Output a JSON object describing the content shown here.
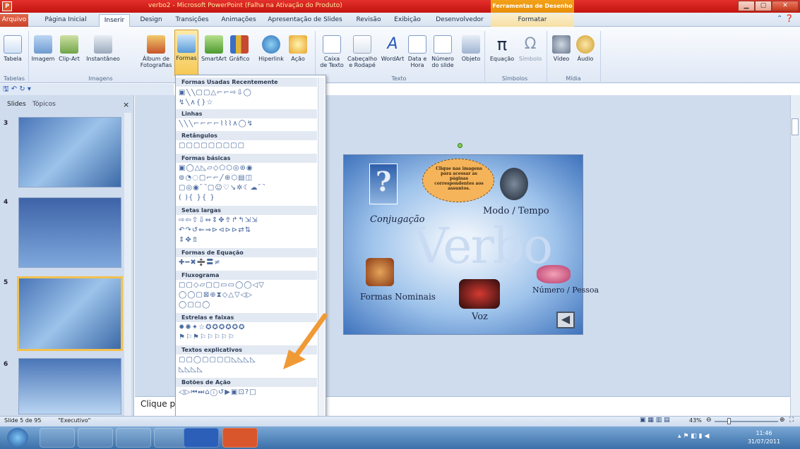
{
  "titlebar": {
    "title": "verbo2 - Microsoft PowerPoint (Falha na Ativação do Produto)",
    "context_tab": "Ferramentas de Desenho",
    "app_icon": "P"
  },
  "tabs": [
    "Arquivo",
    "Página Inicial",
    "Inserir",
    "Design",
    "Transições",
    "Animações",
    "Apresentação de Slides",
    "Revisão",
    "Exibição",
    "Desenvolvedor",
    "Formatar"
  ],
  "ribbon": {
    "tabela": "Tabela",
    "imagem": "Imagem",
    "clipart": "Clip-Art",
    "instantaneo": "Instantâneo",
    "album": "Álbum de",
    "album2": "Fotografias",
    "formas": "Formas",
    "smartart": "SmartArt",
    "grafico": "Gráfico",
    "hyperlink": "Hiperlink",
    "acao": "Ação",
    "caixa": "Caixa",
    "caixa2": "de Texto",
    "cabecalho": "Cabeçalho",
    "cabecalho2": "e Rodapé",
    "wordart": "WordArt",
    "data": "Data e",
    "data2": "Hora",
    "numero": "Número",
    "numero2": "do slide",
    "objeto": "Objeto",
    "equacao": "Equação",
    "simbolo": "Símbolo",
    "video": "Vídeo",
    "audio": "Áudio",
    "groups": {
      "tabelas": "Tabelas",
      "imagens": "Imagens",
      "texto": "Texto",
      "simbolos": "Símbolos",
      "midia": "Mídia"
    }
  },
  "panel": {
    "tab_slides": "Slides",
    "tab_topicos": "Tópicos",
    "close": "×",
    "nums": [
      "3",
      "4",
      "5",
      "6"
    ]
  },
  "shapes_menu": {
    "sections": [
      "Formas Usadas Recentemente",
      "Linhas",
      "Retângulos",
      "Formas básicas",
      "Setas largas",
      "Formas de Equação",
      "Fluxograma",
      "Estrelas e faixas",
      "Textos explicativos",
      "Botões de Ação"
    ],
    "rows": {
      "recent1": "▣╲╲▢▢△⌐⌐⇨⇩◯",
      "recent2": "↯╲∧{}☆",
      "lines": "╲╲╲⌐⌐⌐⌐⌇⌇⌇∧◯↯",
      "rects": "▢▢▢▢▢▢▢▢▢",
      "basic1": "▣◯△◺▱◇⬠⬡◎⊛◉",
      "basic2": "⊚◔◌▢⌐⌐╱⊕⬡▤◫",
      "basic3": "▢◎◉⌒▢☺♡↘✲☾☁⌒",
      "basic4": "( ){ }{ }",
      "arrows1": "⇨⇦⇧⇩⇔⇕✥⇮↱↰⇲⇲",
      "arrows2": "↶↷↺⇐⇒⊳⊲⊳⊳⇄⇅",
      "arrows3": "⇕✥⇯",
      "eq": "✚━✖➗〓≠",
      "flow1": "▢▢◇▱▢▢▭▭◯◯◁▽",
      "flow2": "◯◯▢⊠⊕⧗◇△▽◁▷",
      "flow3": "◯▢▢◯",
      "stars1": "✹✺✦☆✪✪✪✪✪✪",
      "stars2": "⚑⚐⚑⚐⚐⚐⚐⚐",
      "callouts1": "▢▢◯▢▢▢▢◺◺◺◺",
      "callouts2": "◺◺◺◺",
      "action": "◁▷⏮⏭⌂ⓘ↺▶▣⊡?□"
    }
  },
  "slide": {
    "title": "Verbo",
    "cloud": "Clique nas imagens para acessar as páginas correspondentes aos assuntos.",
    "conjugacao": "Conjugação",
    "modo_tempo": "Modo / Tempo",
    "formas_nominais": "Formas Nominais",
    "voz": "Voz",
    "numero_pessoa": "Número / Pessoa"
  },
  "notes": {
    "placeholder": "Clique p"
  },
  "status": {
    "slide_info": "Slide 5 de 95",
    "theme": "\"Executivo\"",
    "zoom": "43%"
  },
  "taskbar": {
    "time": "11:46",
    "date": "31/07/2011"
  },
  "colors": {
    "titlebar": "#d0241f",
    "ribbon": "#dfe8f5",
    "accent_orange": "#f09a36",
    "panel": "#cfdcee"
  }
}
